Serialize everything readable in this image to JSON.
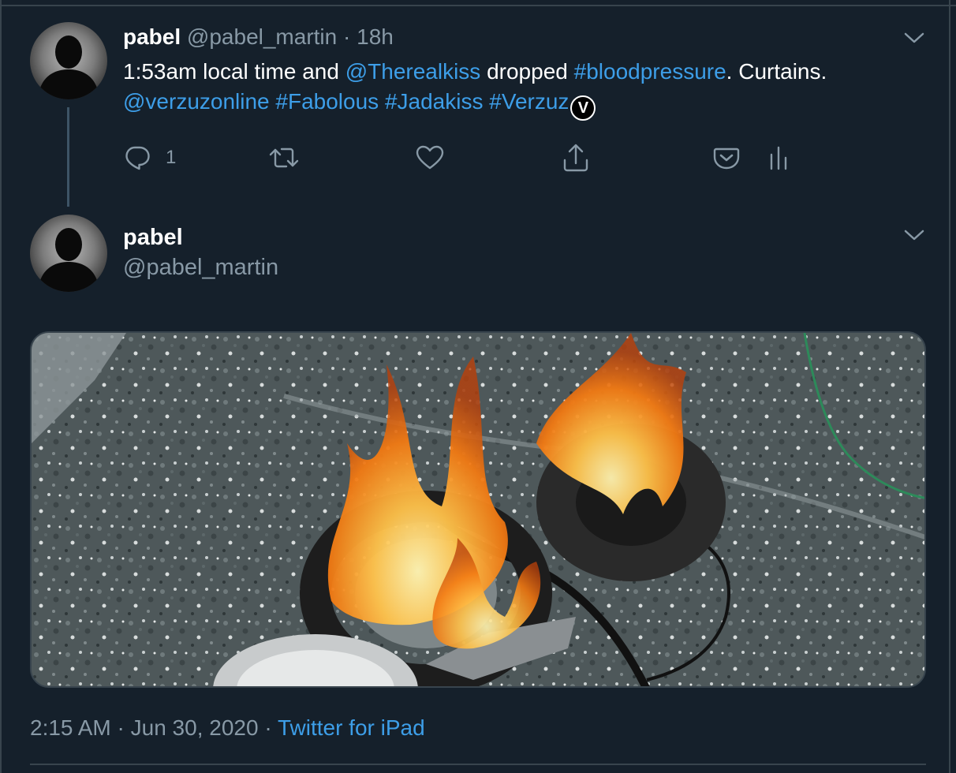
{
  "colors": {
    "background": "#15202b",
    "text_primary": "#ffffff",
    "text_secondary": "#8899a6",
    "link": "#3d9ee8",
    "divider": "#38444d"
  },
  "tweet1": {
    "display_name": "pabel",
    "handle": "@pabel_martin",
    "separator": " · ",
    "time_ago": "18h",
    "text_parts": {
      "p1": "1:53am local time and ",
      "mention1": "@Therealkiss",
      "p2": " dropped ",
      "hashtag1": "#bloodpressure",
      "p3": ".  Curtains.",
      "mention2": "@verzuzonline",
      "hashtag2": "#Fabolous",
      "hashtag3": "#Jadakiss",
      "hashtag4": "#Verzuz",
      "badge_letter": "V"
    },
    "reply_count": "1",
    "icons": {
      "menu": "chevron-down-icon",
      "reply": "reply-icon",
      "retweet": "retweet-icon",
      "like": "heart-icon",
      "share": "share-icon",
      "pocket": "pocket-icon",
      "analytics": "analytics-icon"
    }
  },
  "tweet2": {
    "display_name": "pabel",
    "handle": "@pabel_martin",
    "media_alt": "photo",
    "meta": {
      "time": "2:15 AM",
      "sep1": " · ",
      "date": "Jun 30, 2020",
      "sep2": " · ",
      "source": "Twitter for iPad"
    }
  }
}
